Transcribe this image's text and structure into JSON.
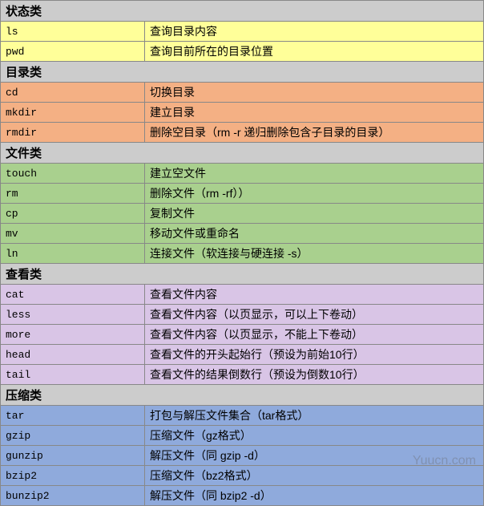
{
  "sections": [
    {
      "title": "状态类",
      "color": "yellow",
      "rows": [
        {
          "cmd": "ls",
          "desc": "查询目录内容"
        },
        {
          "cmd": "pwd",
          "desc": "查询目前所在的目录位置"
        }
      ]
    },
    {
      "title": "目录类",
      "color": "orange",
      "rows": [
        {
          "cmd": "cd",
          "desc": "切换目录"
        },
        {
          "cmd": "mkdir",
          "desc": "建立目录"
        },
        {
          "cmd": "rmdir",
          "desc": "删除空目录（rm -r 递归删除包含子目录的目录）"
        }
      ]
    },
    {
      "title": "文件类",
      "color": "green",
      "rows": [
        {
          "cmd": "touch",
          "desc": "建立空文件"
        },
        {
          "cmd": "rm",
          "desc": "删除文件（rm -rf））"
        },
        {
          "cmd": "cp",
          "desc": "复制文件"
        },
        {
          "cmd": "mv",
          "desc": "移动文件或重命名"
        },
        {
          "cmd": "ln",
          "desc": "连接文件（软连接与硬连接 -s）"
        }
      ]
    },
    {
      "title": "查看类",
      "color": "purple",
      "rows": [
        {
          "cmd": "cat",
          "desc": "查看文件内容"
        },
        {
          "cmd": "less",
          "desc": "查看文件内容（以页显示，可以上下卷动）"
        },
        {
          "cmd": "more",
          "desc": "查看文件内容（以页显示，不能上下卷动）"
        },
        {
          "cmd": "head",
          "desc": "查看文件的开头起始行（预设为前始10行）"
        },
        {
          "cmd": "tail",
          "desc": "查看文件的结果倒数行（预设为倒数10行）"
        }
      ]
    },
    {
      "title": "压缩类",
      "color": "blue",
      "rows": [
        {
          "cmd": "tar",
          "desc": "打包与解压文件集合（tar格式）"
        },
        {
          "cmd": "gzip",
          "desc": "压缩文件（gz格式）"
        },
        {
          "cmd": "gunzip",
          "desc": "解压文件（同 gzip -d）"
        },
        {
          "cmd": "bzip2",
          "desc": "压缩文件（bz2格式）"
        },
        {
          "cmd": "bunzip2",
          "desc": "解压文件（同 bzip2 -d）"
        }
      ]
    }
  ],
  "watermark": "Yuucn.com"
}
